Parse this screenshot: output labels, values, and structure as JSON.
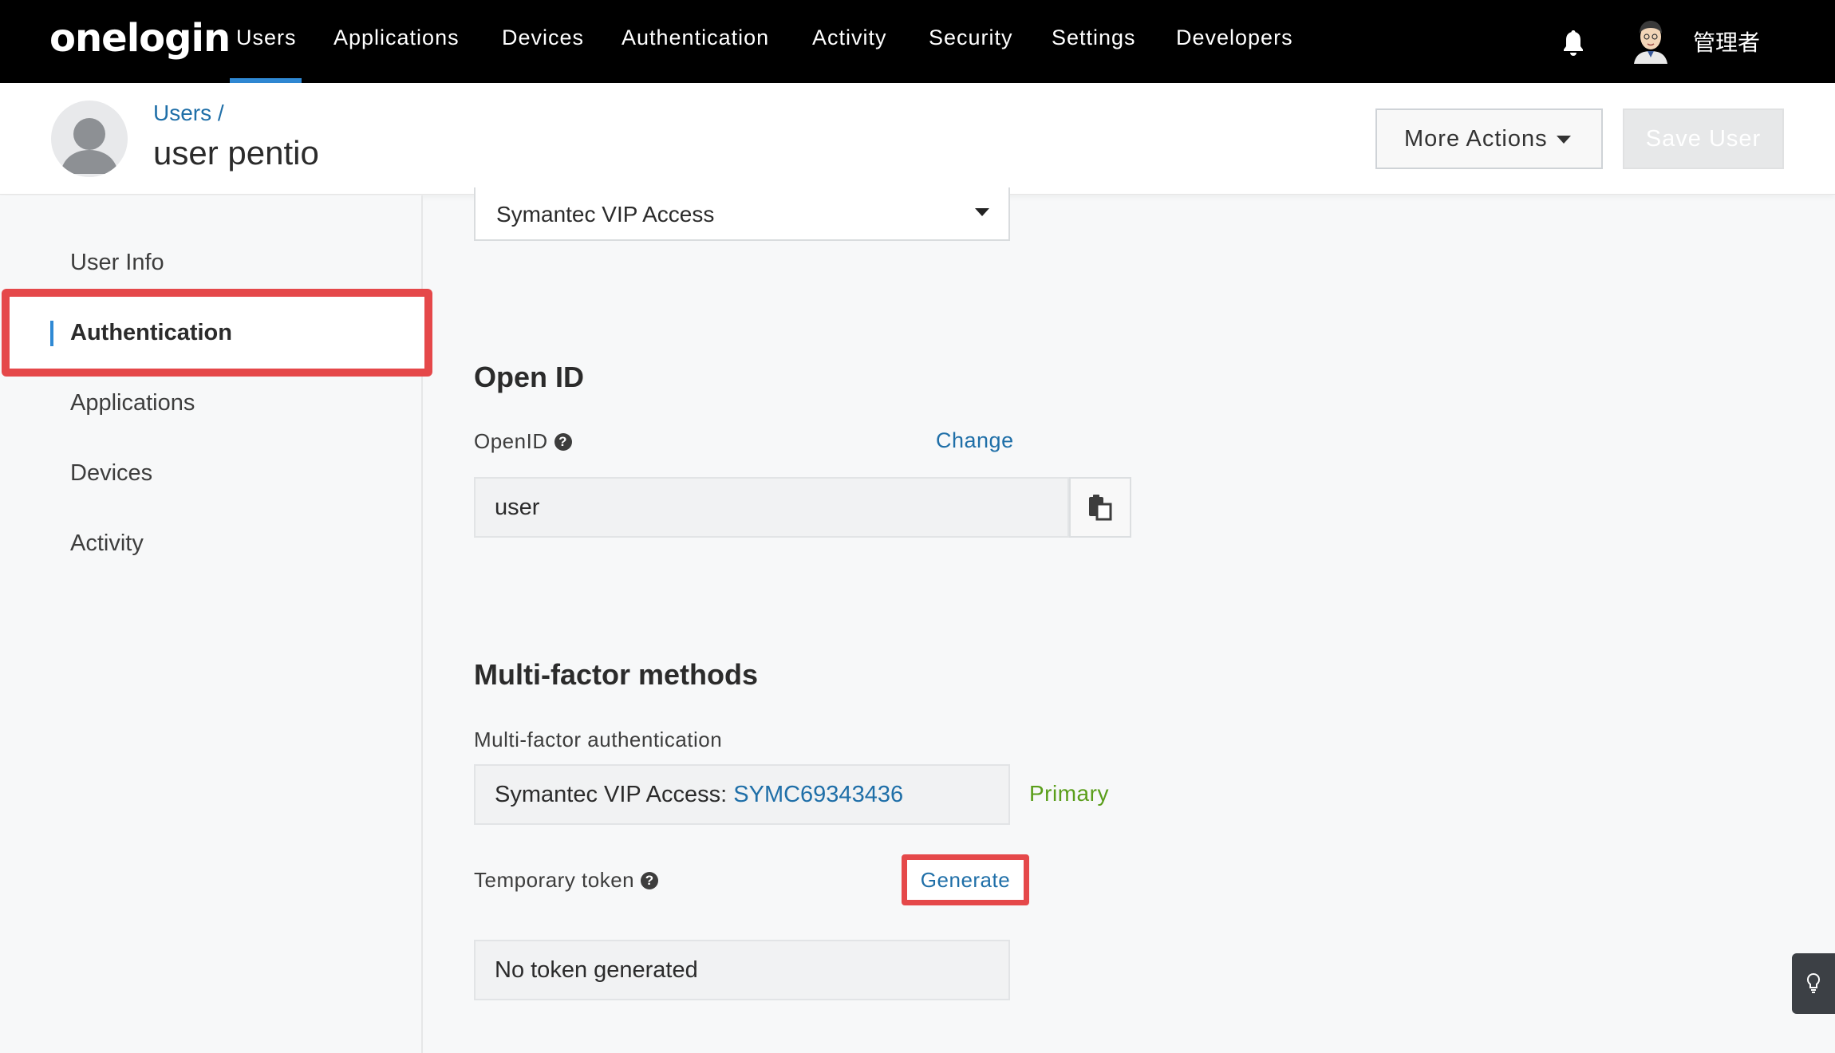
{
  "topnav": {
    "logo": "onelogin",
    "items": [
      "Users",
      "Applications",
      "Devices",
      "Authentication",
      "Activity",
      "Security",
      "Settings",
      "Developers"
    ],
    "active": "Users",
    "admin_name": "管理者"
  },
  "header": {
    "breadcrumb": "Users /",
    "title": "user pentio",
    "more_actions": "More Actions",
    "save_user": "Save User"
  },
  "sidebar": {
    "items": [
      "User Info",
      "Authentication",
      "Applications",
      "Devices",
      "Activity"
    ],
    "active": "Authentication"
  },
  "main": {
    "top_dropdown_value": "Symantec VIP Access",
    "openid_section": {
      "title": "Open ID",
      "label": "OpenID",
      "change_link": "Change",
      "value": "user"
    },
    "mfa_section": {
      "title": "Multi-factor methods",
      "mfa_label": "Multi-factor authentication",
      "mfa_value_prefix": "Symantec VIP Access: ",
      "mfa_value_id": "SYMC69343436",
      "primary_label": "Primary",
      "temp_token_label": "Temporary token",
      "generate_link": "Generate",
      "token_value": "No token generated"
    }
  },
  "colors": {
    "topnav_bg": "#000000",
    "accent_blue": "#2f89d4",
    "link_blue": "#1f6fa8",
    "highlight_red": "#e5484a",
    "primary_green": "#5a9e1a"
  }
}
